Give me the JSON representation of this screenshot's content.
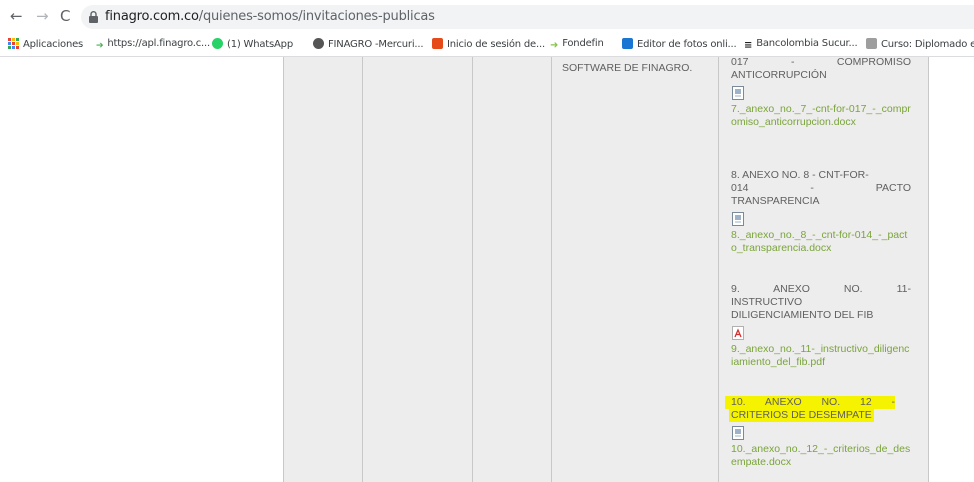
{
  "browser": {
    "back_icon": "←",
    "forward_icon": "→",
    "reload_icon": "C",
    "url_domain": "finagro.com.co",
    "url_path": "/quienes-somos/invitaciones-publicas"
  },
  "bookmarks": [
    {
      "label": "Aplicaciones",
      "color": "#e94235"
    },
    {
      "label": "https://apl.finagro.c...",
      "color": "#4caf50"
    },
    {
      "label": "(1) WhatsApp",
      "color": "#25d366"
    },
    {
      "label": "FINAGRO -Mercuri...",
      "color": "#555555"
    },
    {
      "label": "Inicio de sesión de...",
      "color": "#e64a19"
    },
    {
      "label": "Fondefin",
      "color": "#8bc34a"
    },
    {
      "label": "Editor de fotos onli...",
      "color": "#1976d2"
    },
    {
      "label": "Bancolombia Sucur...",
      "color": "#222222"
    },
    {
      "label": "Curso: Diplomado e...",
      "color": "#9e9e9e"
    }
  ],
  "table": {
    "col4_text": "SOFTWARE DE FINAGRO.",
    "items": [
      {
        "title_lines": [
          "017 - COMPROMISO",
          "ANTICORRUPCIÓN"
        ],
        "link": "7._anexo_no._7_-cnt-for-017_-_compromiso_anticorrupcion.docx",
        "icon": "docx-icon"
      },
      {
        "title_lines": [
          "8. ANEXO No. 8 - CNT-FOR-",
          "014 - PACTO",
          "TRANSPARENCIA"
        ],
        "link": "8._anexo_no._8_-_cnt-for-014_-_pacto_transparencia.docx",
        "icon": "docx-icon"
      },
      {
        "title_lines": [
          "9. ANEXO No. 11-",
          "INSTRUCTIVO",
          "DILIGENCIAMIENTO DEL FIB"
        ],
        "link": "9._anexo_no._11-_instructivo_diligenciamiento_del_fib.pdf",
        "icon": "pdf-icon"
      },
      {
        "title_lines": [
          "10. ANEXO No. 12 -",
          "CRITERIOS DE DESEMPATE"
        ],
        "link": "10._anexo_no._12_-_criterios_de_desempate.docx",
        "icon": "docx-icon"
      }
    ]
  },
  "colors": {
    "link": "#7aa43a",
    "highlight": "#f6f300",
    "table_bg": "#ededed"
  }
}
